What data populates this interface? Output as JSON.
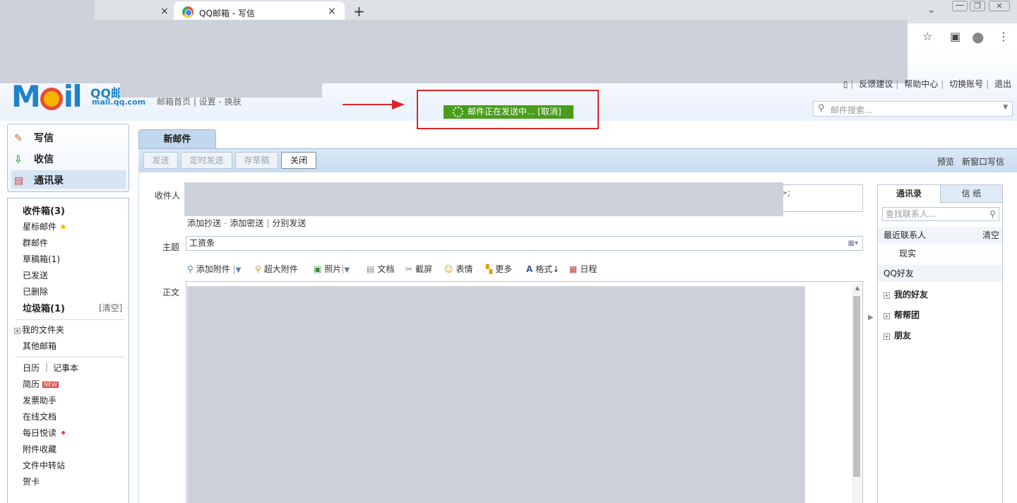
{
  "browser": {
    "tabs": [
      {
        "title": "",
        "close": "×"
      },
      {
        "title": "QQ邮箱 - 写信",
        "close": "×"
      }
    ],
    "new_tab": "+",
    "window_controls": [
      "⌄",
      "—",
      "❐",
      "✕"
    ],
    "toolbar_icons": [
      "☆",
      "▣",
      "●",
      "⋮"
    ]
  },
  "header": {
    "logo_text": "M",
    "logo_text_end": "il",
    "logo_sub": "QQ邮",
    "logo_url": "mail.qq.com",
    "nav": "邮箱首页 | 设置 - 换肤",
    "top_links": [
      "反馈建议",
      "帮助中心",
      "切换账号",
      "退出"
    ],
    "search_placeholder": "邮件搜索..."
  },
  "status": {
    "sending_text": "邮件正在发送中... [取消]"
  },
  "sidebar": {
    "primary": [
      {
        "label": "写信",
        "icon": "pen-icon"
      },
      {
        "label": "收信",
        "icon": "inbox-download-icon"
      },
      {
        "label": "通讯录",
        "icon": "contacts-card-icon"
      }
    ],
    "folders": [
      {
        "label": "收件箱(3)",
        "bold": true
      },
      {
        "label": "星标邮件",
        "bold": false
      },
      {
        "label": "群邮件",
        "bold": false
      },
      {
        "label": "草稿箱(1)",
        "bold": false
      },
      {
        "label": "已发送",
        "bold": false
      },
      {
        "label": "已删除",
        "bold": false
      },
      {
        "label": "垃圾箱(1)",
        "bold": true
      }
    ],
    "junk_clear": "[清空]",
    "my_folders": "我的文件夹",
    "other_mail": "其他邮箱",
    "calendar": "日历",
    "notes": "记事本",
    "apps": [
      "简历",
      "发票助手",
      "在线文档",
      "每日悦读",
      "附件收藏",
      "文件中转站",
      "贺卡"
    ],
    "new_badge": "NEW"
  },
  "compose": {
    "tab_label": "新邮件",
    "buttons": [
      "发送",
      "定时发送",
      "存草稿",
      "关闭"
    ],
    "bar_right": [
      "预览",
      "新窗口写信"
    ],
    "to_label": "收件人",
    "to_tail": ">;",
    "add_links": [
      "添加抄送",
      "添加密送",
      "分别发送"
    ],
    "subject_label": "主题",
    "subject_value": "工资条",
    "tools": [
      {
        "label": "添加附件",
        "icon": "paperclip-icon"
      },
      {
        "label": "超大附件",
        "icon": "large-attachment-icon"
      },
      {
        "label": "照片",
        "icon": "photo-icon"
      },
      {
        "label": "文档",
        "icon": "document-icon"
      },
      {
        "label": "截屏",
        "icon": "screenshot-icon"
      },
      {
        "label": "表情",
        "icon": "emoji-icon"
      },
      {
        "label": "更多",
        "icon": "more-grid-icon"
      },
      {
        "label": "格式↓",
        "icon": "format-icon"
      },
      {
        "label": "日程",
        "icon": "calendar-icon"
      }
    ],
    "body_label": "正文"
  },
  "contacts": {
    "tabs": [
      "通讯录",
      "信 纸"
    ],
    "search_placeholder": "查找联系人...",
    "recent_label": "最近联系人",
    "recent_clear": "清空",
    "recent_items": [
      "现实"
    ],
    "qq_friends": "QQ好友",
    "groups": [
      "我的好友",
      "帮帮团",
      "朋友"
    ]
  }
}
